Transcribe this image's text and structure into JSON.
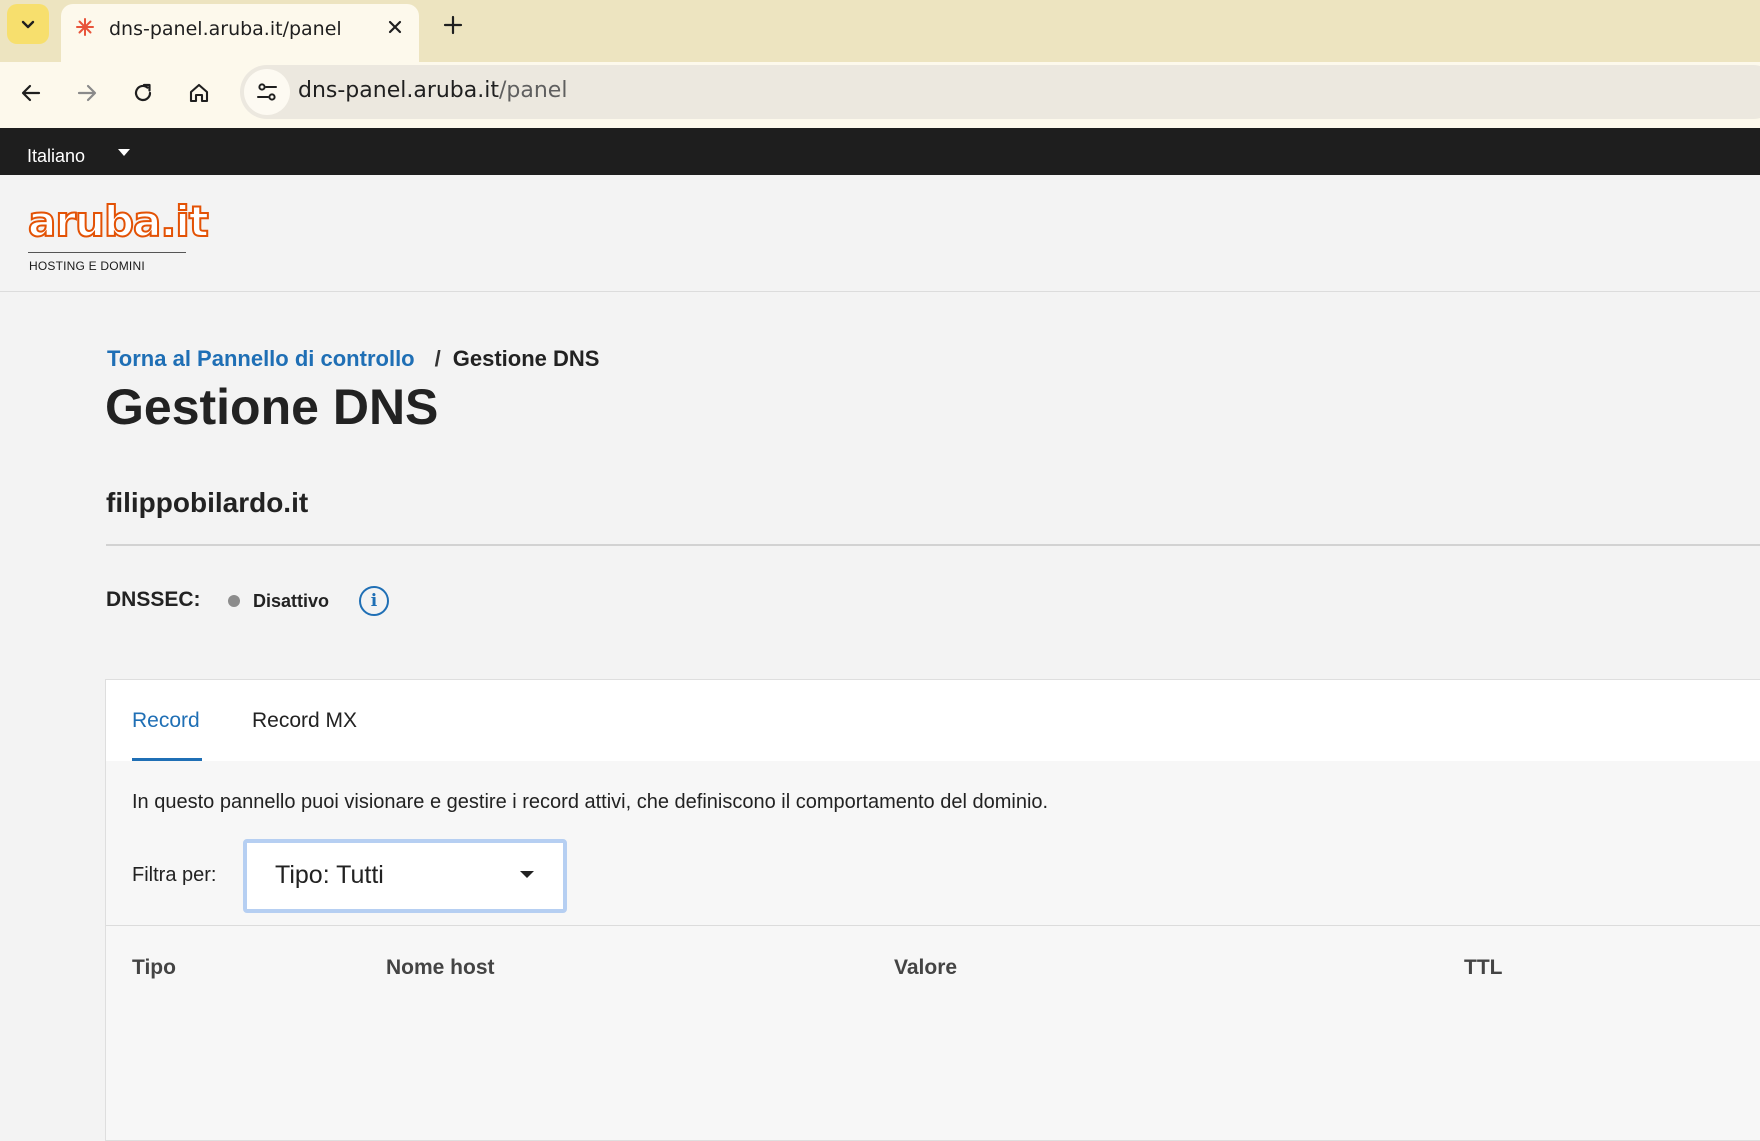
{
  "browser": {
    "tab_title": "dns-panel.aruba.it/panel",
    "url_host": "dns-panel.aruba.it",
    "url_path": "/panel"
  },
  "lang_bar": {
    "language": "Italiano"
  },
  "logo": {
    "wordmark": "aruba.it",
    "tagline": "HOSTING E DOMINI",
    "brand_color": "#e35205"
  },
  "breadcrumb": {
    "back_link": "Torna al Pannello di controllo",
    "separator": "/",
    "current": "Gestione DNS"
  },
  "page": {
    "title": "Gestione DNS",
    "domain": "filippobilardo.it",
    "dnssec_label": "DNSSEC:",
    "dnssec_status": "Disattivo",
    "info_glyph": "i"
  },
  "panel": {
    "tabs": [
      {
        "label": "Record",
        "active": true
      },
      {
        "label": "Record MX",
        "active": false
      }
    ],
    "description": "In questo pannello puoi visionare e gestire i record attivi, che definiscono il comportamento del dominio.",
    "filter_label": "Filtra per:",
    "filter_value": "Tipo: Tutti",
    "columns": [
      "Tipo",
      "Nome host",
      "Valore",
      "TTL"
    ]
  },
  "colors": {
    "accent": "#1f6fb5",
    "topbar": "#1e1e1e",
    "status_inactive": "#8c8c8c"
  }
}
